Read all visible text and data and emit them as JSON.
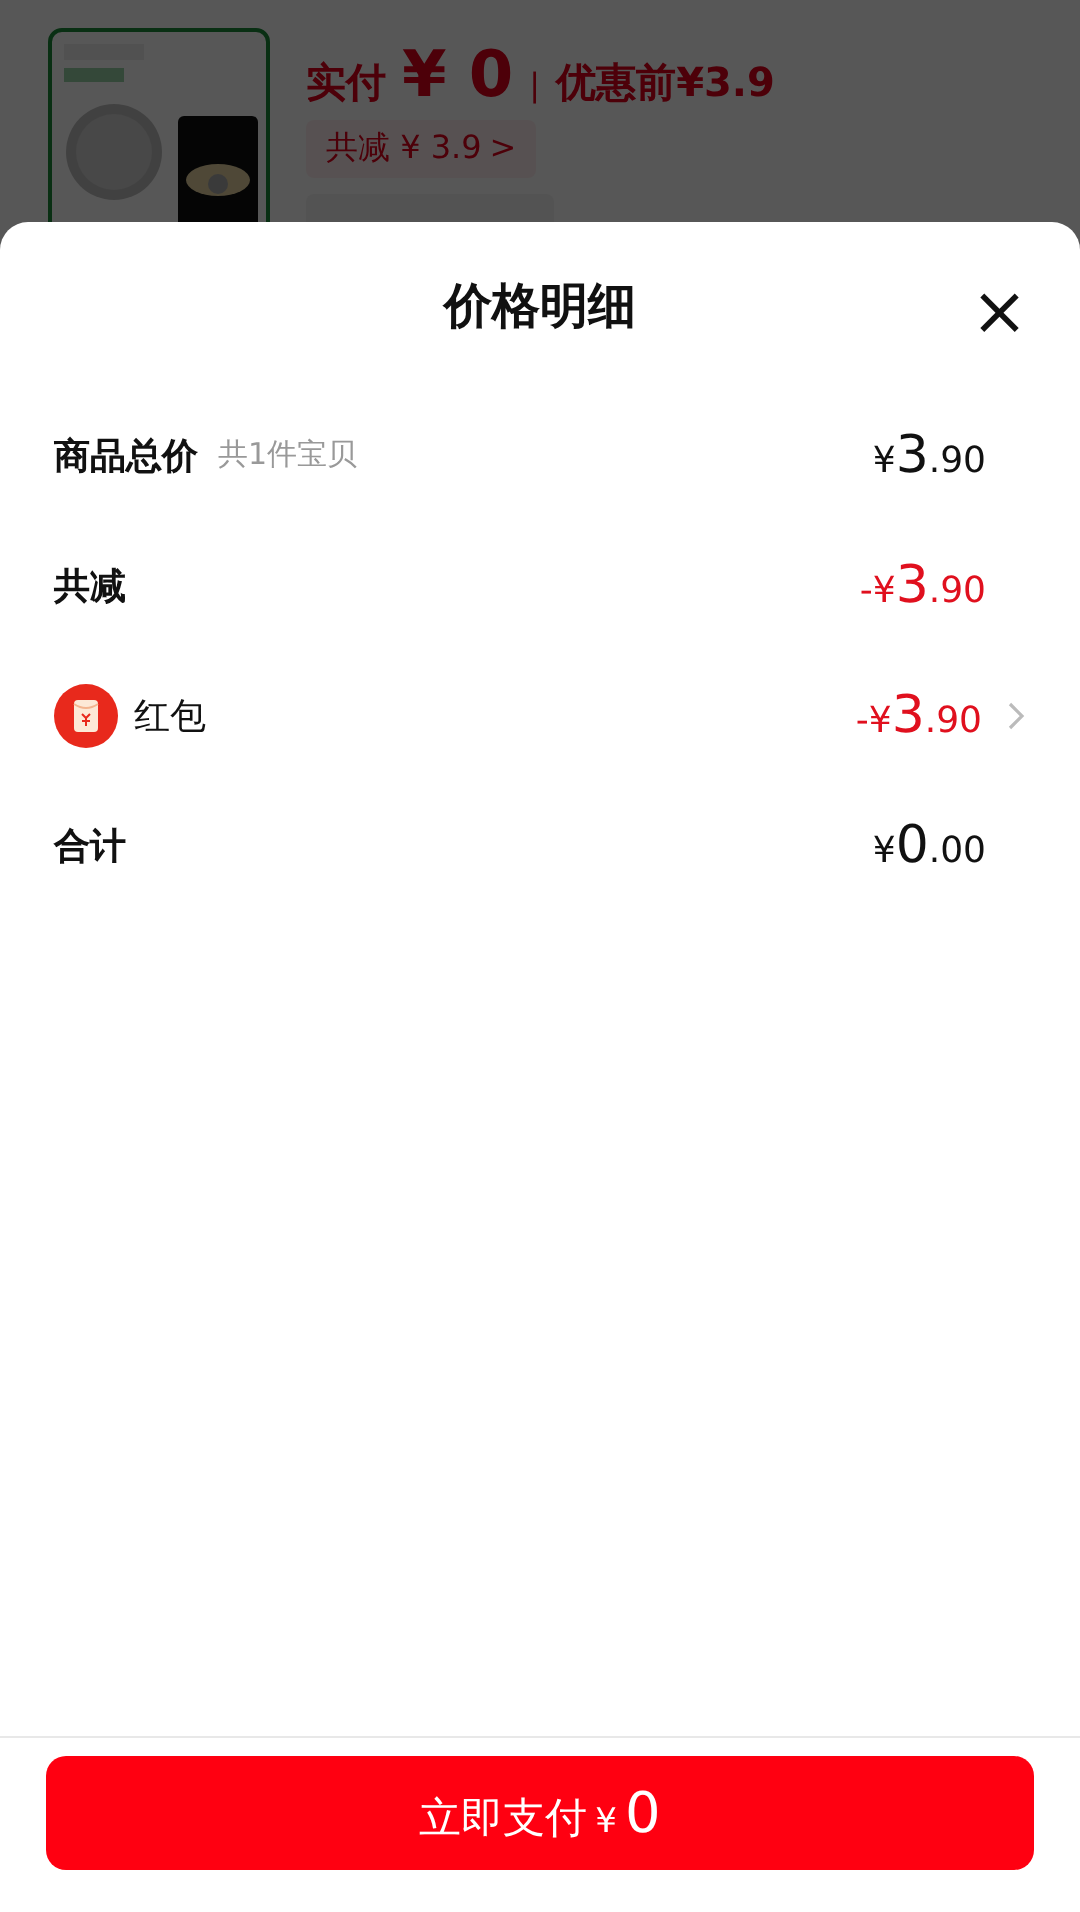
{
  "background_page": {
    "paid_label": "实付",
    "paid_currency": "¥",
    "paid_amount": "0",
    "separator": "|",
    "original_price": "优惠前¥3.9",
    "discount_chip": {
      "label": "共减 ¥ 3.9",
      "chevron": ">"
    }
  },
  "sheet": {
    "title": "价格明细",
    "close": "×",
    "rows": [
      {
        "label": "商品总价",
        "note": "共1件宝贝",
        "kind": "plain",
        "discount": false,
        "amount_prefix": "¥",
        "amount_integer": "3",
        "amount_decimals": ".90"
      },
      {
        "label": "共减",
        "kind": "plain",
        "discount": true,
        "amount_prefix": "-¥",
        "amount_integer": "3",
        "amount_decimals": ".90"
      },
      {
        "label": "红包",
        "kind": "red-packet",
        "discount": true,
        "amount_prefix": "-¥",
        "amount_integer": "3",
        "amount_decimals": ".90"
      },
      {
        "label": "合计",
        "kind": "plain",
        "discount": false,
        "amount_prefix": "¥",
        "amount_integer": "0",
        "amount_decimals": ".00"
      }
    ],
    "pay_button": {
      "label": "立即支付",
      "currency": "¥",
      "amount": "0"
    }
  }
}
